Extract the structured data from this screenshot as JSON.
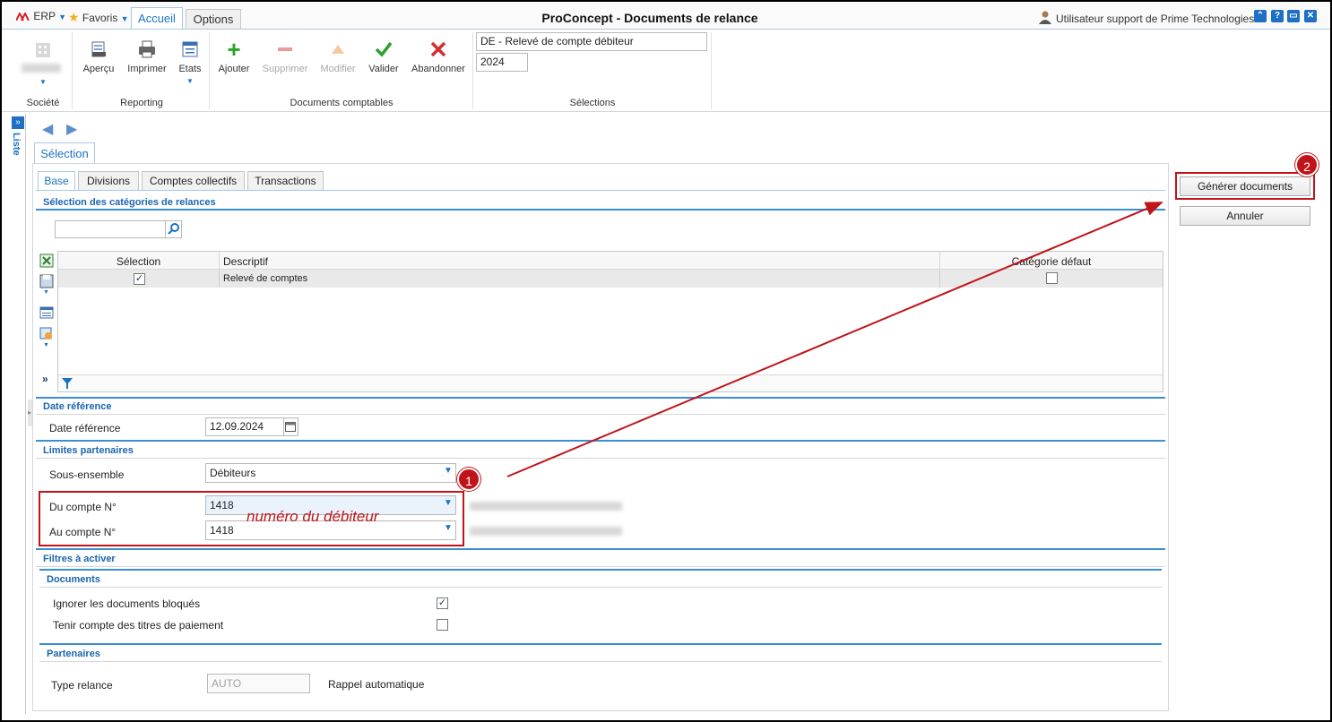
{
  "titlebar": {
    "erp_label": "ERP",
    "favoris_label": "Favoris",
    "tabs": [
      {
        "label": "Accueil"
      },
      {
        "label": "Options"
      }
    ],
    "app_title": "ProConcept - Documents de relance",
    "user_label": "Utilisateur support de Prime Technologies"
  },
  "ribbon": {
    "groups": {
      "societe": "Société",
      "reporting": "Reporting",
      "documents": "Documents comptables",
      "selections": "Sélections"
    },
    "buttons": {
      "apercu": "Aperçu",
      "imprimer": "Imprimer",
      "etats": "Etats",
      "ajouter": "Ajouter",
      "supprimer": "Supprimer",
      "modifier": "Modifier",
      "valider": "Valider",
      "abandonner": "Abandonner"
    },
    "selection_document": "DE - Relevé de compte débiteur",
    "selection_year": "2024"
  },
  "sidebar": {
    "liste_label": "Liste"
  },
  "main": {
    "main_tab": "Sélection",
    "subtabs": [
      {
        "label": "Base"
      },
      {
        "label": "Divisions"
      },
      {
        "label": "Comptes collectifs"
      },
      {
        "label": "Transactions"
      }
    ],
    "categories": {
      "title": "Sélection des catégories de relances",
      "search_value": "",
      "columns": {
        "selection": "Sélection",
        "descriptif": "Descriptif",
        "defaut": "Catégorie défaut"
      },
      "rows": [
        {
          "selection": true,
          "descriptif": "Relevé de comptes",
          "defaut": false
        }
      ],
      "more_label": "»"
    },
    "date_ref": {
      "section_title": "Date référence",
      "label": "Date référence",
      "value": "12.09.2024"
    },
    "limites": {
      "section_title": "Limites partenaires",
      "sous_ensemble_label": "Sous-ensemble",
      "sous_ensemble_value": "Débiteurs",
      "du_compte_label": "Du compte N°",
      "du_compte_value": "1418",
      "au_compte_label": "Au compte N°",
      "au_compte_value": "1418"
    },
    "filtres": {
      "section_title": "Filtres à activer",
      "documents": {
        "title": "Documents",
        "ignorer_label": "Ignorer les documents bloqués",
        "ignorer_checked": true,
        "tenir_label": "Tenir compte des titres de paiement",
        "tenir_checked": false
      },
      "partenaires": {
        "title": "Partenaires",
        "type_relance_label": "Type relance",
        "type_relance_value": "AUTO",
        "rappel_label": "Rappel automatique"
      }
    }
  },
  "actions": {
    "generer": "Générer documents",
    "annuler": "Annuler"
  },
  "annotations": {
    "badge1": "1",
    "badge2": "2",
    "note": "numéro du débiteur",
    "color": "#c0141a"
  }
}
